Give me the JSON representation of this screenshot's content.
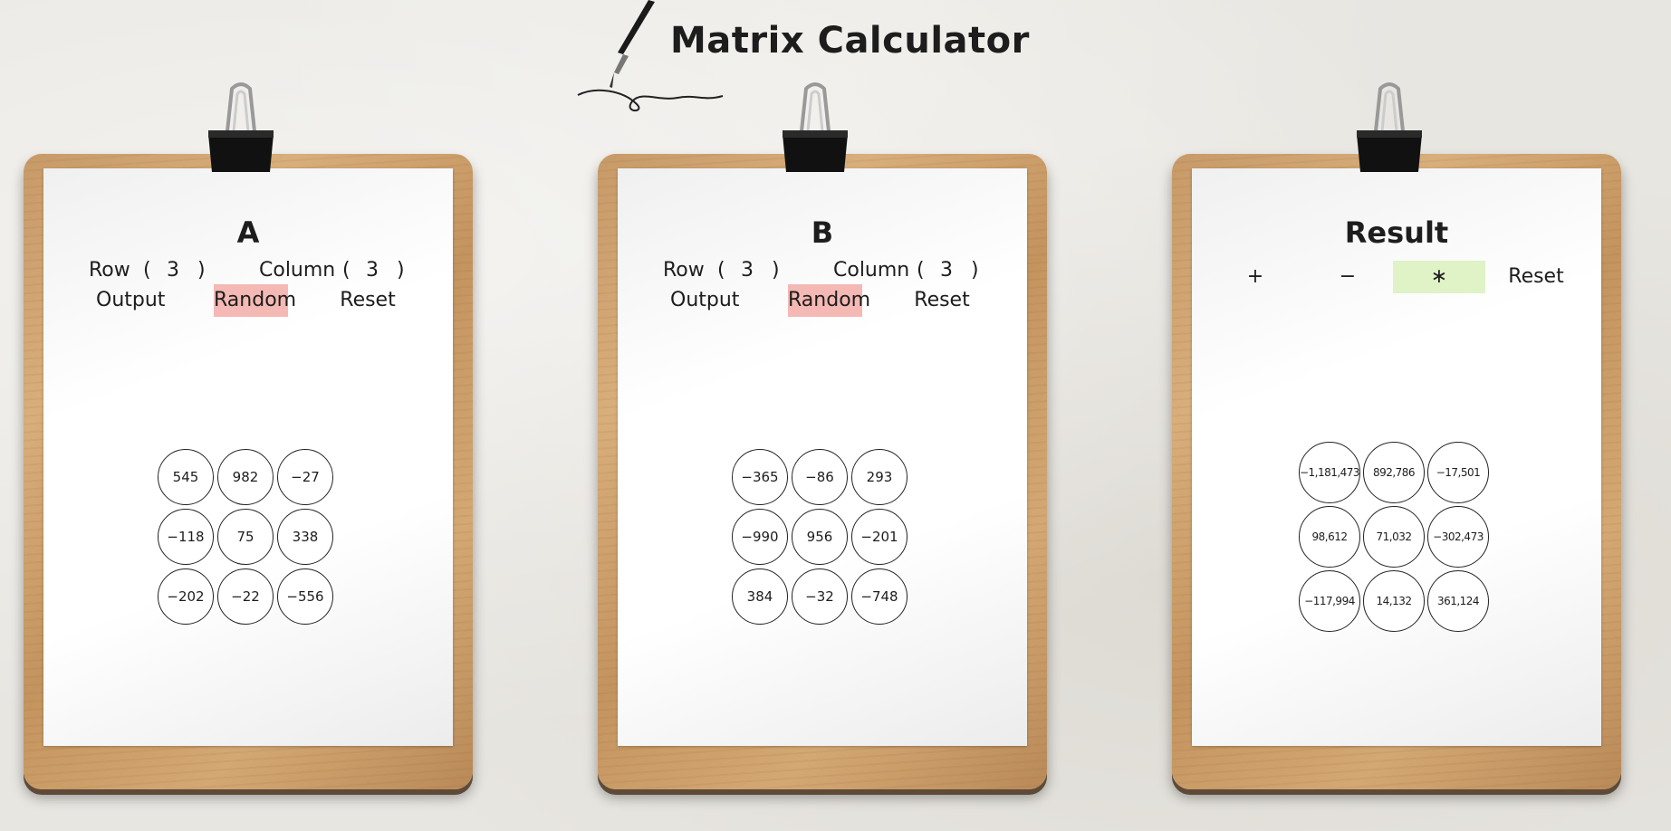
{
  "app_title": "Matrix Calculator",
  "matrix_a": {
    "title": "A",
    "row_label": "Row",
    "row_value": "3",
    "column_label": "Column",
    "column_value": "3",
    "buttons": {
      "output": "Output",
      "random": "Random",
      "reset": "Reset"
    },
    "values": [
      [
        "545",
        "982",
        "−27"
      ],
      [
        "−118",
        "75",
        "338"
      ],
      [
        "−202",
        "−22",
        "−556"
      ]
    ]
  },
  "matrix_b": {
    "title": "B",
    "row_label": "Row",
    "row_value": "3",
    "column_label": "Column",
    "column_value": "3",
    "buttons": {
      "output": "Output",
      "random": "Random",
      "reset": "Reset"
    },
    "values": [
      [
        "−365",
        "−86",
        "293"
      ],
      [
        "−990",
        "956",
        "−201"
      ],
      [
        "384",
        "−32",
        "−748"
      ]
    ]
  },
  "result": {
    "title": "Result",
    "ops": {
      "add": "+",
      "subtract": "−",
      "multiply": "∗",
      "reset": "Reset"
    },
    "active_op": "multiply",
    "values": [
      [
        "−1,181,473",
        "892,786",
        "−17,501"
      ],
      [
        "98,612",
        "71,032",
        "−302,473"
      ],
      [
        "−117,994",
        "14,132",
        "361,124"
      ]
    ]
  },
  "colors": {
    "random_highlight": "#f4b9b4",
    "active_op_highlight": "#dff3c7"
  },
  "icons": {
    "decor": [
      "fountain-pen-icon",
      "binder-clip-icon"
    ]
  }
}
